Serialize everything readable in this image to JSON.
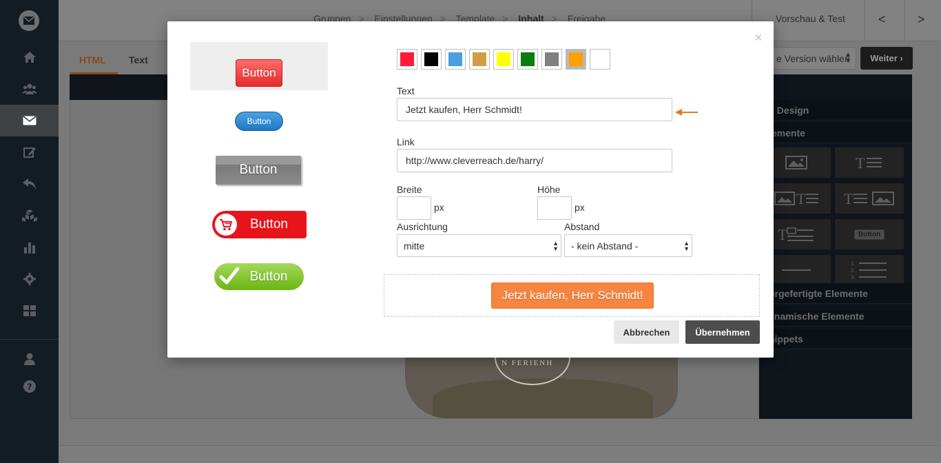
{
  "breadcrumb": {
    "items": [
      "Gruppen",
      "Einstellungen",
      "Template",
      "Inhalt",
      "Freigabe"
    ],
    "active_index": 3,
    "separator": ">"
  },
  "header": {
    "preview_label": "Vorschau & Test",
    "prev_arrow": "<",
    "next_arrow": ">"
  },
  "editor": {
    "tabs": [
      "HTML",
      "Text"
    ],
    "active_tab": "HTML",
    "version_select": "e Version wählen",
    "next_button": "Weiter ›"
  },
  "right_panel": {
    "sections": [
      "e Design",
      "lemente",
      "orgefertigte Elemente",
      "ynamische Elemente",
      "nippets"
    ],
    "button_tile_label": "Button"
  },
  "canvas": {
    "stamp_text": "N FERIENH"
  },
  "modal": {
    "close": "×",
    "button_styles": [
      {
        "label": "Button",
        "selected": true
      },
      {
        "label": "Button"
      },
      {
        "label": "Button"
      },
      {
        "label": "Button"
      },
      {
        "label": "Button"
      }
    ],
    "colors": [
      "#ff1a3a",
      "#000000",
      "#4a9fe0",
      "#d29e45",
      "#ffff00",
      "#0a7d0f",
      "#808080",
      "#ff9f00",
      "#ffffff"
    ],
    "selected_color_index": 7,
    "text_label": "Text",
    "text_value": "Jetzt kaufen, Herr Schmidt!",
    "link_label": "Link",
    "link_value": "http://www.cleverreach.de/harry/",
    "width_label": "Breite",
    "width_value": "",
    "height_label": "Höhe",
    "height_value": "",
    "unit": "px",
    "align_label": "Ausrichtung",
    "align_value": "mitte",
    "spacing_label": "Abstand",
    "spacing_value": "- kein Abstand -",
    "preview_text": "Jetzt kaufen, Herr Schmidt!",
    "cancel_label": "Abbrechen",
    "apply_label": "Übernehmen"
  }
}
